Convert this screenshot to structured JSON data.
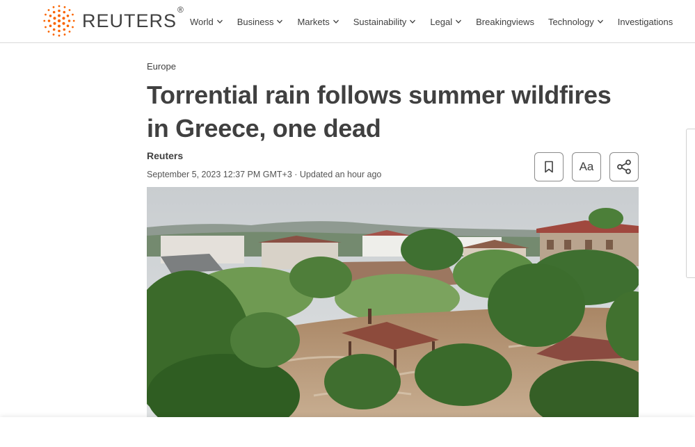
{
  "brand": {
    "name": "REUTERS",
    "reg": "®",
    "color": "#fa6400"
  },
  "nav": [
    {
      "label": "World",
      "dropdown": true
    },
    {
      "label": "Business",
      "dropdown": true
    },
    {
      "label": "Markets",
      "dropdown": true
    },
    {
      "label": "Sustainability",
      "dropdown": true
    },
    {
      "label": "Legal",
      "dropdown": true
    },
    {
      "label": "Breakingviews",
      "dropdown": false
    },
    {
      "label": "Technology",
      "dropdown": true
    },
    {
      "label": "Investigations",
      "dropdown": false
    }
  ],
  "article": {
    "section": "Europe",
    "headline": "Torrential rain follows summer wildfires in Greece, one dead",
    "author": "Reuters",
    "dateline": "September 5, 2023 12:37 PM GMT+3 · Updated an hour ago"
  },
  "tools": {
    "bookmark_icon": "bookmark-icon",
    "text_size_label": "Aa",
    "share_icon": "share-icon"
  }
}
